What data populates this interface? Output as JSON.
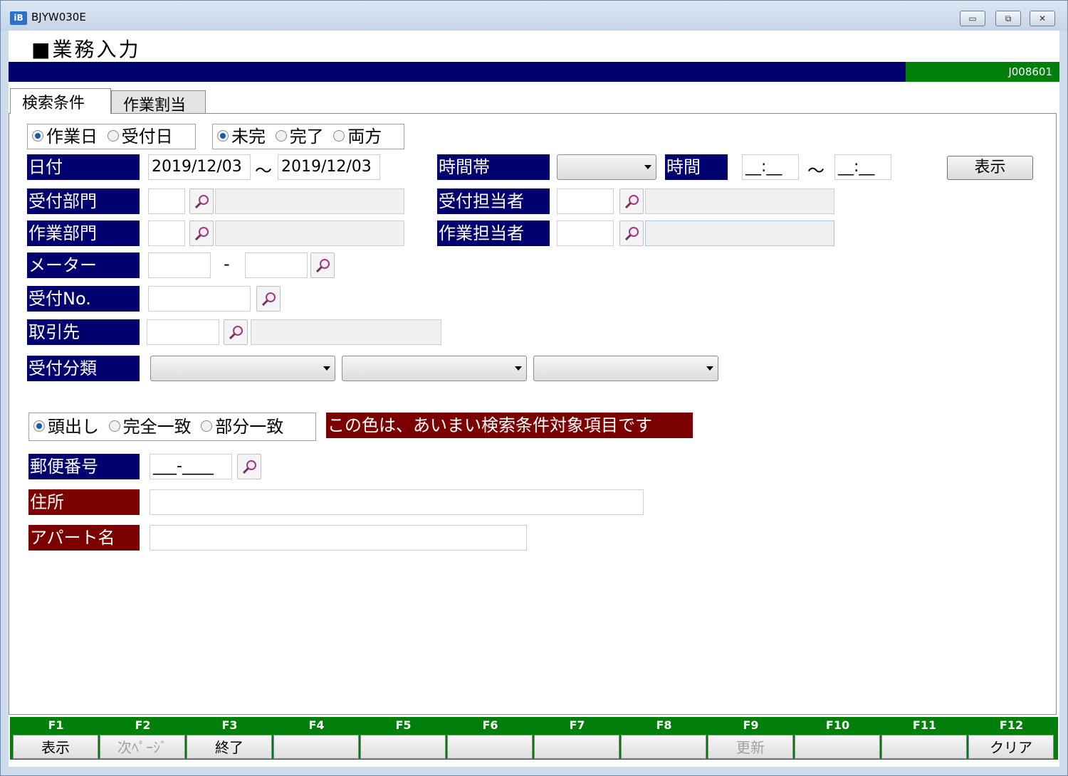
{
  "window": {
    "title": "BJYW030E",
    "icon_text": "iB",
    "min_label": "▭",
    "max_label": "⧉",
    "close_label": "✕"
  },
  "page": {
    "heading": "■業務入力",
    "screen_code": "J008601"
  },
  "tabs": [
    "検索条件",
    "作業割当"
  ],
  "date_type": {
    "options": [
      "作業日",
      "受付日"
    ],
    "selected": "作業日"
  },
  "status": {
    "options": [
      "未完",
      "完了",
      "両方"
    ],
    "selected": "未完"
  },
  "date": {
    "label": "日付",
    "from": "2019/12/03",
    "sep": "～",
    "to": "2019/12/03"
  },
  "timeband": {
    "label": "時間帯",
    "value": ""
  },
  "time": {
    "label": "時間",
    "from": "__:__",
    "sep": "～",
    "to": "__:__"
  },
  "show_button": "表示",
  "recv_dept": {
    "label": "受付部門",
    "code": "",
    "name": ""
  },
  "recv_person": {
    "label": "受付担当者",
    "code": "",
    "name": ""
  },
  "work_dept": {
    "label": "作業部門",
    "code": "",
    "name": ""
  },
  "work_person": {
    "label": "作業担当者",
    "code": "",
    "name": ""
  },
  "meter": {
    "label": "メーター",
    "from": "",
    "sep": "-",
    "to": ""
  },
  "recv_no": {
    "label": "受付No.",
    "value": ""
  },
  "client": {
    "label": "取引先",
    "code": "",
    "name": ""
  },
  "recv_class": {
    "label": "受付分類",
    "values": [
      "",
      "",
      ""
    ]
  },
  "match": {
    "options": [
      "頭出し",
      "完全一致",
      "部分一致"
    ],
    "selected": "頭出し"
  },
  "fuzzy_note": "この色は、あいまい検索条件対象項目です",
  "postal": {
    "label": "郵便番号",
    "value": "___-____"
  },
  "address": {
    "label": "住所",
    "value": ""
  },
  "apartment": {
    "label": "アパート名",
    "value": ""
  },
  "fkeys": [
    {
      "key": "F1",
      "label": "表示",
      "enabled": true
    },
    {
      "key": "F2",
      "label": "次ﾍﾟｰｼﾞ",
      "enabled": false
    },
    {
      "key": "F3",
      "label": "終了",
      "enabled": true
    },
    {
      "key": "F4",
      "label": "",
      "enabled": false
    },
    {
      "key": "F5",
      "label": "",
      "enabled": false
    },
    {
      "key": "F6",
      "label": "",
      "enabled": false
    },
    {
      "key": "F7",
      "label": "",
      "enabled": false
    },
    {
      "key": "F8",
      "label": "",
      "enabled": false
    },
    {
      "key": "F9",
      "label": "更新",
      "enabled": false
    },
    {
      "key": "F10",
      "label": "",
      "enabled": false
    },
    {
      "key": "F11",
      "label": "",
      "enabled": false
    },
    {
      "key": "F12",
      "label": "クリア",
      "enabled": true
    }
  ],
  "colors": {
    "label_blue": "#00006e",
    "label_red": "#7b0000",
    "green_bar": "#00800a"
  }
}
